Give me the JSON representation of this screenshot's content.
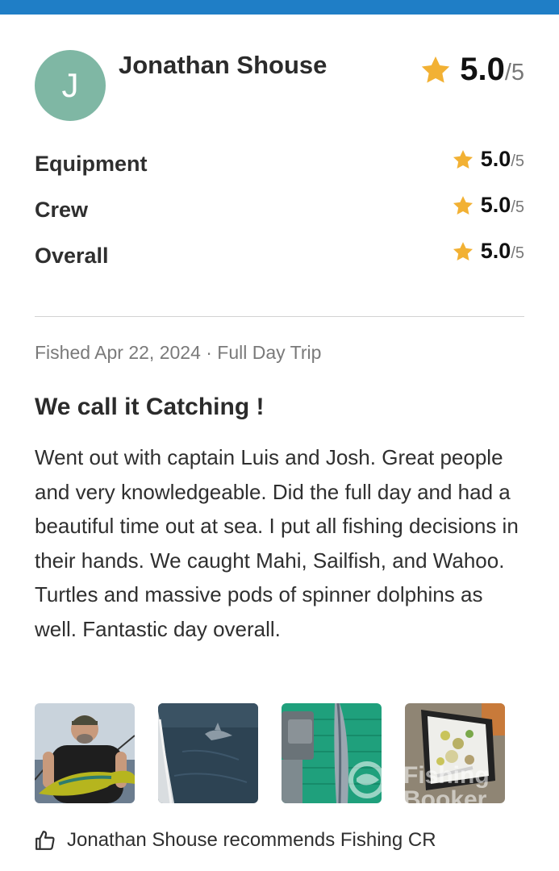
{
  "reviewer": {
    "initial": "J",
    "name": "Jonathan Shouse",
    "avatar_color": "#7fb7a4"
  },
  "overall_rating": {
    "value": "5.0",
    "denominator": "/5",
    "icon": "star-icon",
    "star_color": "#f2b134"
  },
  "categories": [
    {
      "label": "Equipment",
      "value": "5.0",
      "denominator": "/5"
    },
    {
      "label": "Crew",
      "value": "5.0",
      "denominator": "/5"
    },
    {
      "label": "Overall",
      "value": "5.0",
      "denominator": "/5"
    }
  ],
  "meta": "Fished Apr 22, 2024 · Full Day Trip",
  "review": {
    "title": "We call it Catching !",
    "body": "Went out with captain Luis and Josh. Great people and very knowledgeable. Did the full day and had a beautiful time out at sea. I put all fishing decisions in their hands. We caught Mahi, Sailfish, and Wahoo. Turtles and massive pods of spinner dolphins as well. Fantastic day overall."
  },
  "watermark": {
    "line1": "Fishing",
    "line2": "Booker"
  },
  "recommendation": {
    "icon": "thumbs-up-icon",
    "text": "Jonathan Shouse recommends Fishing CR"
  },
  "colors": {
    "top_bar": "#1f7ec6",
    "star": "#f2b134"
  }
}
